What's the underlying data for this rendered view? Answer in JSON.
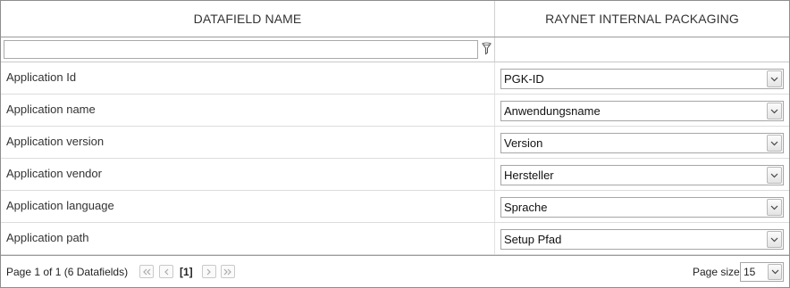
{
  "columns": {
    "datafield": "DATAFIELD NAME",
    "packaging": "RAYNET INTERNAL PACKAGING"
  },
  "filter": {
    "value": "",
    "icon": "filter-icon"
  },
  "rows": [
    {
      "label": "Application Id",
      "selected": "PGK-ID"
    },
    {
      "label": "Application name",
      "selected": "Anwendungsname"
    },
    {
      "label": "Application version",
      "selected": "Version"
    },
    {
      "label": "Application vendor",
      "selected": "Hersteller"
    },
    {
      "label": "Application language",
      "selected": "Sprache"
    },
    {
      "label": "Application path",
      "selected": "Setup Pfad"
    }
  ],
  "pager": {
    "info": "Page 1 of 1 (6 Datafields)",
    "current_page": "[1]",
    "page_size_label": "Page size",
    "page_size": "15",
    "icons": [
      "first-page-icon",
      "prev-page-icon",
      "next-page-icon",
      "last-page-icon"
    ]
  }
}
